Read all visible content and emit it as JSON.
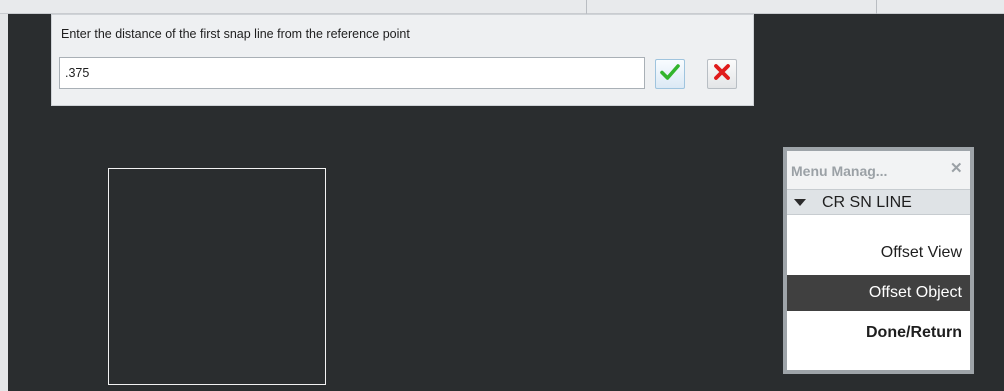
{
  "prompt": {
    "label": "Enter the distance of the first snap line from the reference point",
    "input_value": ".375",
    "ok_icon": "green-checkmark-icon",
    "cancel_icon": "red-x-icon",
    "colors": {
      "ok": "#33b52c",
      "cancel": "#e01b1b"
    }
  },
  "menu_manager": {
    "title": "Menu Manag...",
    "close_glyph": "✕",
    "section": {
      "label": "CR SN LINE",
      "icon": "caret-down-icon"
    },
    "items": [
      {
        "label": "Offset View",
        "state": "normal"
      },
      {
        "label": "Offset Object",
        "state": "highlighted"
      },
      {
        "label": "Done/Return",
        "state": "bold"
      }
    ],
    "highlight_color": "#404040"
  },
  "canvas": {
    "background": "#2a2d2f",
    "sketch_color": "#f2f2f2"
  }
}
